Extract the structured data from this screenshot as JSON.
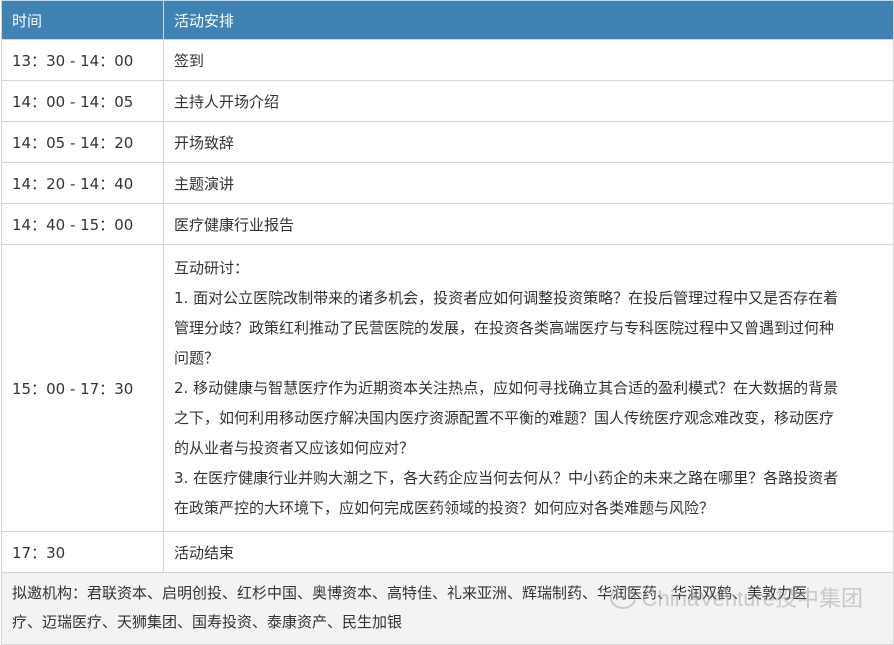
{
  "headers": {
    "time": "时间",
    "activity": "活动安排"
  },
  "rows": [
    {
      "time": "13：30 - 14：00",
      "activity": "签到"
    },
    {
      "time": "14：00 - 14：05",
      "activity": "主持人开场介绍"
    },
    {
      "time": "14：05 - 14：20",
      "activity": "开场致辞"
    },
    {
      "time": "14：20 - 14：40",
      "activity": "主题演讲"
    },
    {
      "time": "14：40 - 15：00",
      "activity": "医疗健康行业报告"
    }
  ],
  "discussion": {
    "time": "15：00 - 17：30",
    "lines": [
      "互动研讨：",
      "1. 面对公立医院改制带来的诸多机会，投资者应如何调整投资策略？在投后管理过程中又是否存在着",
      "管理分歧？政策红利推动了民营医院的发展，在投资各类高端医疗与专科医院过程中又曾遇到过何种",
      "问题？",
      "2. 移动健康与智慧医疗作为近期资本关注热点，应如何寻找确立其合适的盈利模式？在大数据的背景",
      "之下，如何利用移动医疗解决国内医疗资源配置不平衡的难题？国人传统医疗观念难改变，移动医疗",
      "的从业者与投资者又应该如何应对？",
      "3. 在医疗健康行业并购大潮之下，各大药企应当何去何从？中小药企的未来之路在哪里？各路投资者",
      "在政策严控的大环境下，应如何完成医药领域的投资？如何应对各类难题与风险？"
    ]
  },
  "end_row": {
    "time": "17：30",
    "activity": "活动结束"
  },
  "invite": {
    "line1": "拟邀机构：君联资本、启明创投、红杉中国、奥博资本、高特佳、礼来亚洲、辉瑞制药、华润医药、华润双鹤、美敦力医",
    "line2": "疗、迈瑞医疗、天狮集团、国寿投资、泰康资产、民生加银"
  },
  "watermark": "ChinaVenture投中集团"
}
